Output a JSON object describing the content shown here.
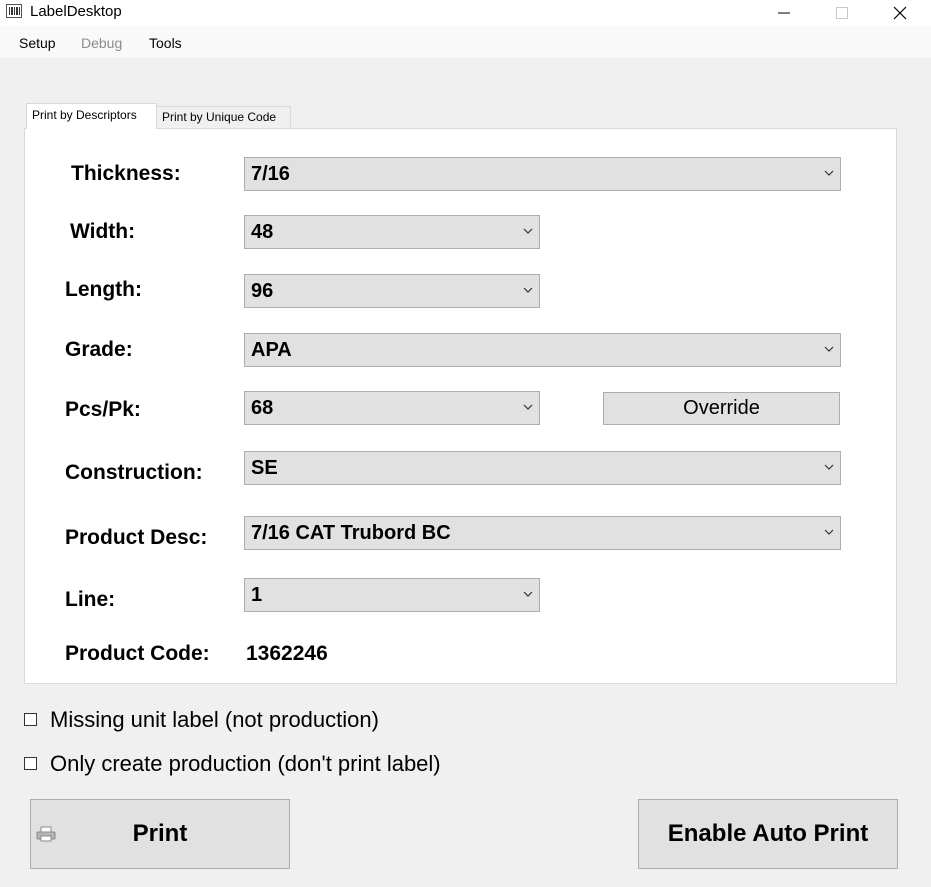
{
  "window": {
    "title": "LabelDesktop"
  },
  "menu": {
    "setup": "Setup",
    "debug": "Debug",
    "tools": "Tools"
  },
  "tabs": {
    "descriptors": "Print by Descriptors",
    "unique_code": "Print by Unique Code"
  },
  "fields": {
    "thickness": {
      "label": "Thickness:",
      "value": "7/16"
    },
    "width": {
      "label": "Width:",
      "value": "48"
    },
    "length": {
      "label": "Length:",
      "value": "96"
    },
    "grade": {
      "label": "Grade:",
      "value": "APA"
    },
    "pcs_pk": {
      "label": "Pcs/Pk:",
      "value": "68"
    },
    "construction": {
      "label": "Construction:",
      "value": "SE"
    },
    "product_desc": {
      "label": "Product Desc:",
      "value": "7/16 CAT Trubord BC"
    },
    "line": {
      "label": "Line:",
      "value": "1"
    },
    "product_code": {
      "label": "Product Code:",
      "value": "1362246"
    }
  },
  "buttons": {
    "override": "Override",
    "print": "Print",
    "enable_auto_print": "Enable Auto Print"
  },
  "options": {
    "missing_unit_label": {
      "label": "Missing unit label (not production)",
      "checked": false
    },
    "only_create_production": {
      "label": "Only create production (don't print label)",
      "checked": false
    }
  },
  "icons": {
    "app": "app-icon",
    "minimize": "minimize-icon",
    "maximize": "maximize-icon",
    "close": "close-icon",
    "dropdown": "chevron-down-icon",
    "printer": "printer-icon"
  }
}
